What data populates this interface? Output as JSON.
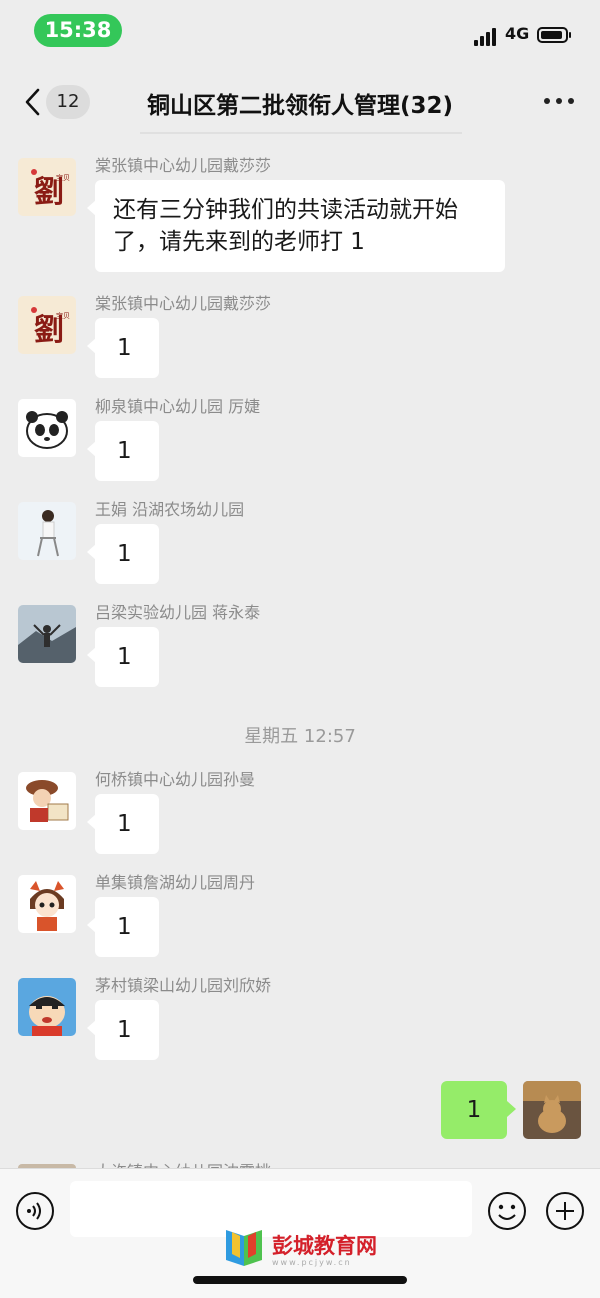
{
  "status_bar": {
    "time": "15:38",
    "network": "4G"
  },
  "nav": {
    "unread_count": "12",
    "title": "铜山区第二批领衔人管理(32)"
  },
  "messages": [
    {
      "sender": "棠张镇中心幼儿园戴莎莎",
      "text": "还有三分钟我们的共读活动就开始了，请先来到的老师打 1",
      "avatar": "calligraphy-avatar"
    },
    {
      "sender": "棠张镇中心幼儿园戴莎莎",
      "text": "1",
      "avatar": "calligraphy-avatar"
    },
    {
      "sender": "柳泉镇中心幼儿园 厉婕",
      "text": "1",
      "avatar": "panda-avatar"
    },
    {
      "sender": "王娟 沿湖农场幼儿园",
      "text": "1",
      "avatar": "person-chair-avatar"
    },
    {
      "sender": "吕梁实验幼儿园 蒋永泰",
      "text": "1",
      "avatar": "mountain-person-avatar"
    },
    {
      "sender": "何桥镇中心幼儿园孙曼",
      "text": "1",
      "avatar": "cartoon-hat-avatar"
    },
    {
      "sender": "单集镇詹湖幼儿园周丹",
      "text": "1",
      "avatar": "cartoon-girl-avatar"
    },
    {
      "sender": "茅村镇梁山幼儿园刘欣娇",
      "text": "1",
      "avatar": "crayon-shin-avatar"
    }
  ],
  "timestamp": "星期五 12:57",
  "self_message": {
    "text": "1",
    "avatar": "cat-avatar"
  },
  "cutoff_sender": "大许镇中心幼儿园沈霞桃",
  "input": {
    "placeholder": ""
  },
  "watermark": {
    "text": "彭城教育网",
    "sub": "www.pcjyw.cn"
  },
  "colors": {
    "self_bubble": "#95ec69",
    "time_pill": "#34c759",
    "background": "#ededed",
    "watermark": "#d4202a"
  }
}
